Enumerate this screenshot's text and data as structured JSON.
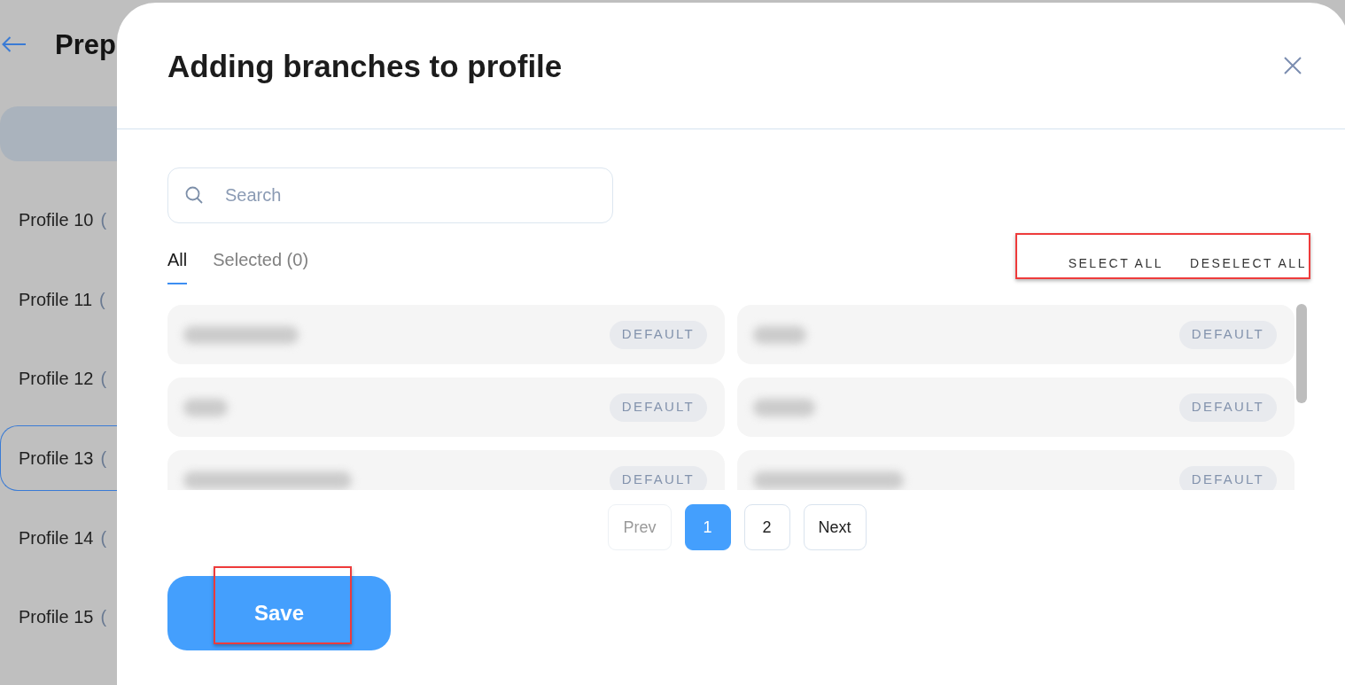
{
  "page": {
    "title": "Prep",
    "profiles": [
      {
        "name": "Profile 10",
        "count": "(",
        "selected": false
      },
      {
        "name": "Profile 11",
        "count": "(",
        "selected": false
      },
      {
        "name": "Profile 12",
        "count": "(",
        "selected": false
      },
      {
        "name": "Profile 13",
        "count": "(",
        "selected": true
      },
      {
        "name": "Profile 14",
        "count": "(",
        "selected": false
      },
      {
        "name": "Profile 15",
        "count": "(",
        "selected": false
      }
    ]
  },
  "dialog": {
    "title": "Adding branches to profile",
    "search": {
      "placeholder": "Search"
    },
    "tabs": [
      {
        "label": "All",
        "selected": true
      },
      {
        "label": "Selected (0)",
        "selected": false
      }
    ],
    "select_actions": {
      "highlighted": true,
      "buttons": [
        "SELECT ALL",
        "DESELECT ALL"
      ]
    },
    "branches": [
      {
        "badge": "DEFAULT"
      },
      {
        "badge": "DEFAULT"
      },
      {
        "badge": "DEFAULT"
      },
      {
        "badge": "DEFAULT"
      },
      {
        "badge": "DEFAULT"
      },
      {
        "badge": "DEFAULT"
      }
    ],
    "pagination": [
      {
        "label": "Prev",
        "kind": "nav",
        "disabled": true
      },
      {
        "label": "1",
        "kind": "page",
        "selected": true
      },
      {
        "label": "2",
        "kind": "page",
        "selected": false
      },
      {
        "label": "Next",
        "kind": "nav",
        "disabled": false
      }
    ],
    "save": {
      "label": "Save",
      "highlighted": true
    }
  }
}
